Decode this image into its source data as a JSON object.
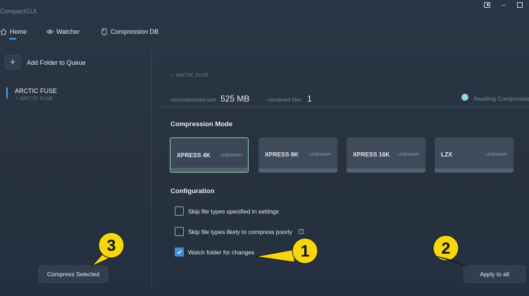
{
  "window": {
    "title": "CompactGUI",
    "pin_icon": "pin-icon",
    "minimize_symbol": "–"
  },
  "nav": {
    "tabs": [
      {
        "label": "Home",
        "icon": "home-icon",
        "active": true
      },
      {
        "label": "Watcher",
        "icon": "eye-icon"
      },
      {
        "label": "Compression DB",
        "icon": "database-icon"
      }
    ]
  },
  "sidebar": {
    "add_symbol": "+",
    "add_label": "Add Folder to Queue",
    "queue": [
      {
        "title": "ARCTIC FUSE",
        "subtitle": "✓ ARCTIC FUSE"
      }
    ],
    "compress_selected_label": "Compress Selected"
  },
  "folder_info": {
    "path_partial": "✓ ARCTIC FUSE",
    "uncompressed_label": "uncompressed size",
    "uncompressed_value": "525 MB",
    "files_label": "contained files",
    "files_value": "1",
    "status_text": "Awaiting Compression"
  },
  "compression_mode": {
    "title": "Compression Mode",
    "selected": "XPRESS 4K",
    "modes": [
      {
        "name": "XPRESS 4K",
        "status": "unknown"
      },
      {
        "name": "XPRESS 8K",
        "status": "unknown"
      },
      {
        "name": "XPRESS 16K",
        "status": "unknown"
      },
      {
        "name": "LZX",
        "status": "unknown"
      }
    ]
  },
  "configuration": {
    "title": "Configuration",
    "options": [
      {
        "label": "Skip file types specified in settings",
        "checked": false
      },
      {
        "label": "Skip file types likely to compress poorly",
        "checked": false,
        "help": "?"
      },
      {
        "label": "Watch folder for changes",
        "checked": true
      }
    ]
  },
  "apply_all_label": "Apply to all",
  "callouts": [
    {
      "number": "1"
    },
    {
      "number": "2"
    },
    {
      "number": "3"
    }
  ],
  "colors": {
    "accent": "#4aa3e8",
    "checkbox_checked": "#3a8fdc",
    "callout_fill": "#f6d70f",
    "status_dot": "#8fd6e8",
    "selected_mode_border": "#8fc9b4"
  }
}
